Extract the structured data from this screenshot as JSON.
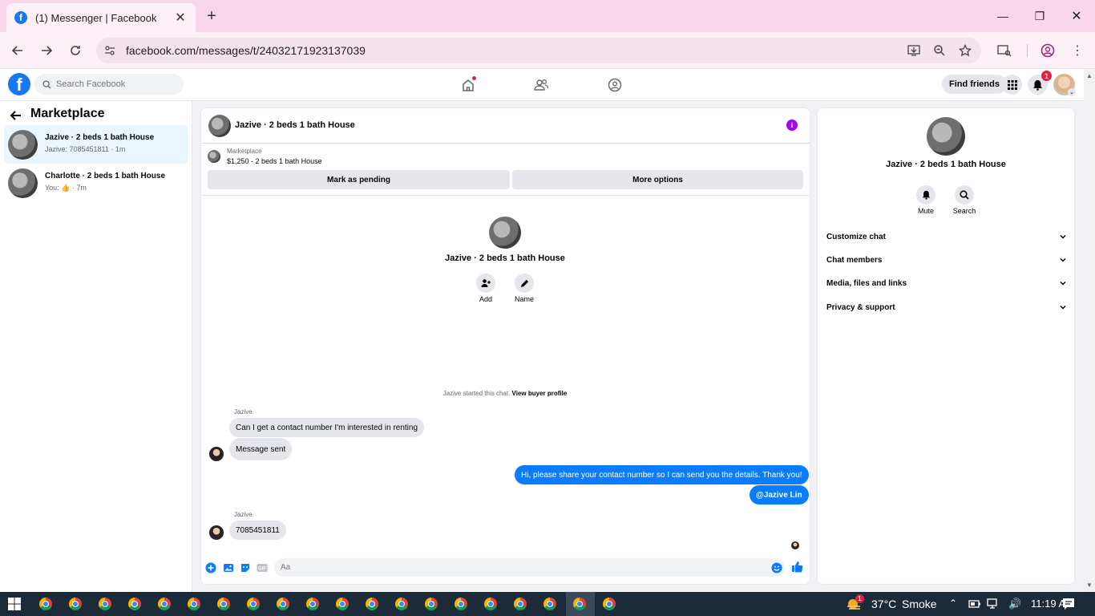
{
  "browser": {
    "tab_title": "(1) Messenger | Facebook",
    "url": "facebook.com/messages/t/24032171923137039"
  },
  "fb_header": {
    "search_placeholder": "Search Facebook",
    "find_friends": "Find friends",
    "notification_count": "1"
  },
  "left": {
    "title": "Marketplace",
    "conversations": [
      {
        "name": "Jazive · 2 beds 1 bath House",
        "preview": "Jazive: 7085451811 · 1m"
      },
      {
        "name": "Charlotte · 2 beds 1 bath House",
        "preview": "You: 👍 · 7m"
      }
    ]
  },
  "chat": {
    "title": "Jazive · 2 beds 1 bath House",
    "marketplace_label": "Marketplace",
    "listing": "$1,250 - 2 beds 1 bath House",
    "mark_pending": "Mark as pending",
    "more_options": "More options",
    "center_name": "Jazive · 2 beds 1 bath House",
    "add_label": "Add",
    "name_label": "Name",
    "system_text": "Jazive started this chat. ",
    "system_link": "View buyer profile",
    "messages": [
      {
        "sender": "Jazive",
        "text": "Can I get a contact number I'm interested in renting"
      },
      {
        "text": "Message sent"
      },
      {
        "text": "Hi, please share your contact number so I can send you the details. Thank you!"
      },
      {
        "text": "@Jazive Lin"
      },
      {
        "sender": "Jazive",
        "text": "7085451811"
      }
    ],
    "composer_placeholder": "Aa"
  },
  "details": {
    "name": "Jazive · 2 beds 1 bath House",
    "mute": "Mute",
    "search": "Search",
    "sections": [
      "Customize chat",
      "Chat members",
      "Media, files and links",
      "Privacy & support"
    ]
  },
  "taskbar": {
    "weather_badge": "1",
    "temperature": "37°C",
    "condition": "Smoke",
    "time": "11:19 AM"
  },
  "colors": {
    "fb_blue": "#1877f2",
    "outgoing_bubble": "#0a7cff",
    "tab_strip": "#f8d7ea",
    "info_purple": "#a100ff"
  }
}
